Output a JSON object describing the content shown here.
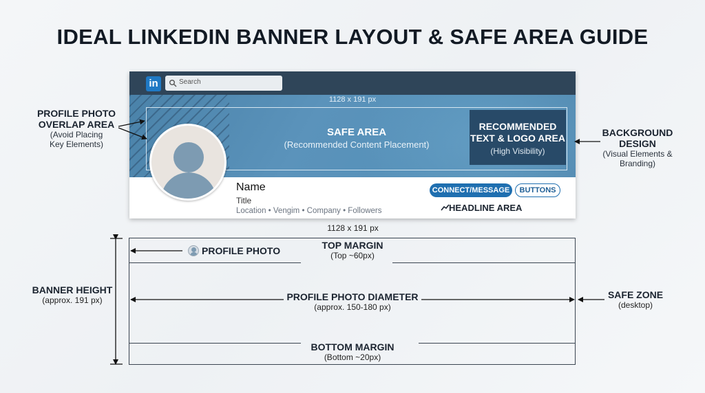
{
  "title": "IDEAL LINKEDIN BANNER LAYOUT & SAFE AREA GUIDE",
  "mockup": {
    "logo": "in",
    "search_placeholder": "Search",
    "dimension_label": "1128 x 191 px",
    "safe_area": {
      "title": "SAFE AREA",
      "subtitle": "(Recommended Content Placement)"
    },
    "recommended_box": {
      "line1": "RECOMMENDED",
      "line2": "TEXT & LOGO AREA",
      "line3": "(High Visibility)"
    },
    "profile": {
      "name": "Name",
      "title": "Title",
      "meta": "Location • Vengim • Company  •  Followers"
    },
    "connect_button": "CONNECT/MESSAGE",
    "buttons_button": "BUTTONS",
    "headline_area": "HEADLINE AREA"
  },
  "callouts": {
    "profile_overlap": {
      "line1": "PROFILE PHOTO",
      "line2": "OVERLAP AREA",
      "line3": "(Avoid Placing",
      "line4": "Key Elements)"
    },
    "background_design": {
      "line1": "BACKGROUND",
      "line2": "DESIGN",
      "line3": "(Visual Elements &",
      "line4": "Branding)"
    }
  },
  "diagram": {
    "dimension_label": "1128 x 191 px",
    "profile_photo": "PROFILE PHOTO",
    "top_margin": {
      "label": "TOP MARGIN",
      "value": "(Top ~60px)"
    },
    "diameter": {
      "label": "PROFILE PHOTO DIAMETER",
      "value": "(approx. 150-180 px)"
    },
    "bottom_margin": {
      "label": "BOTTOM MARGIN",
      "value": "(Bottom ~20px)"
    },
    "banner_height": {
      "label": "BANNER HEIGHT",
      "value": "(approx. 191 px)"
    },
    "safe_zone": {
      "label": "SAFE ZONE",
      "value": "(desktop)"
    }
  },
  "colors": {
    "banner": "#5590b8",
    "topbar": "#2f4559",
    "recommended_box": "#284a68",
    "button": "#1f6fb0"
  },
  "icons": [
    "linkedin-logo-icon",
    "search-icon",
    "avatar-icon",
    "trend-icon",
    "arrow-icon"
  ]
}
